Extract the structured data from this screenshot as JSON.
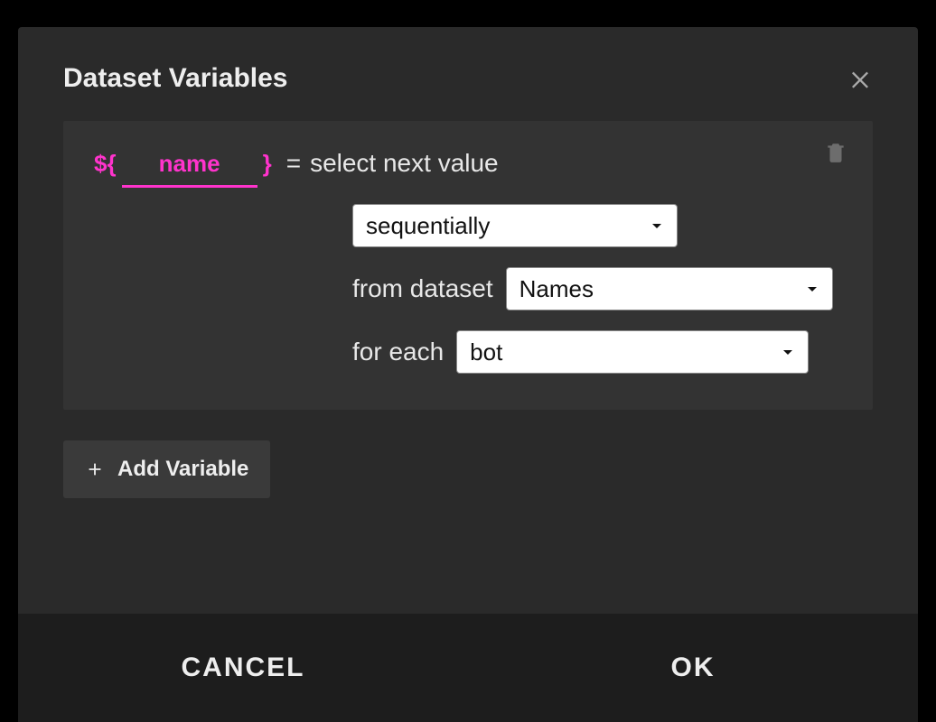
{
  "dialog": {
    "title": "Dataset Variables",
    "variable": {
      "syntax_open": "${",
      "syntax_close": "}",
      "name": "name",
      "equals": "=",
      "select_next_label": "select next value",
      "mode_value": "sequentially",
      "from_label": "from dataset",
      "dataset_value": "Names",
      "foreach_label": "for each",
      "scope_value": "bot"
    },
    "add_button": "Add Variable",
    "cancel": "CANCEL",
    "ok": "OK"
  }
}
